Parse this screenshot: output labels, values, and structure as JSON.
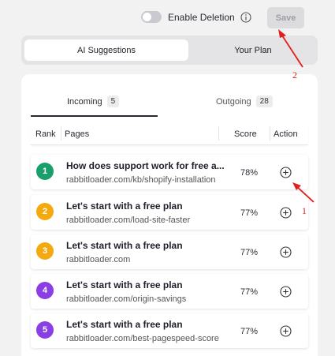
{
  "topbar": {
    "toggle_label": "Enable Deletion",
    "toggle_on": false,
    "save_label": "Save"
  },
  "tabs": [
    {
      "label": "AI Suggestions",
      "active": true
    },
    {
      "label": "Your Plan",
      "active": false
    }
  ],
  "subtabs": {
    "incoming": {
      "label": "Incoming",
      "count": "5"
    },
    "outgoing": {
      "label": "Outgoing",
      "count": "28"
    }
  },
  "table": {
    "headers": {
      "rank": "Rank",
      "pages": "Pages",
      "score": "Score",
      "action": "Action"
    },
    "rows": [
      {
        "rank": "1",
        "color": "#1a9e6c",
        "title": "How does support work for free a...",
        "url": "rabbitloader.com/kb/shopify-installation",
        "score": "78%"
      },
      {
        "rank": "2",
        "color": "#f4a90f",
        "title": "Let's start with a free plan",
        "url": "rabbitloader.com/load-site-faster",
        "score": "77%"
      },
      {
        "rank": "3",
        "color": "#f4a90f",
        "title": "Let's start with a free plan",
        "url": "rabbitloader.com",
        "score": "77%"
      },
      {
        "rank": "4",
        "color": "#8a3ee6",
        "title": "Let's start with a free plan",
        "url": "rabbitloader.com/origin-savings",
        "score": "77%"
      },
      {
        "rank": "5",
        "color": "#8a3ee6",
        "title": "Let's start with a free plan",
        "url": "rabbitloader.com/best-pagespeed-score",
        "score": "77%"
      }
    ]
  },
  "annotations": {
    "marker_1": "1",
    "marker_2": "2",
    "color": "#e0201c"
  }
}
